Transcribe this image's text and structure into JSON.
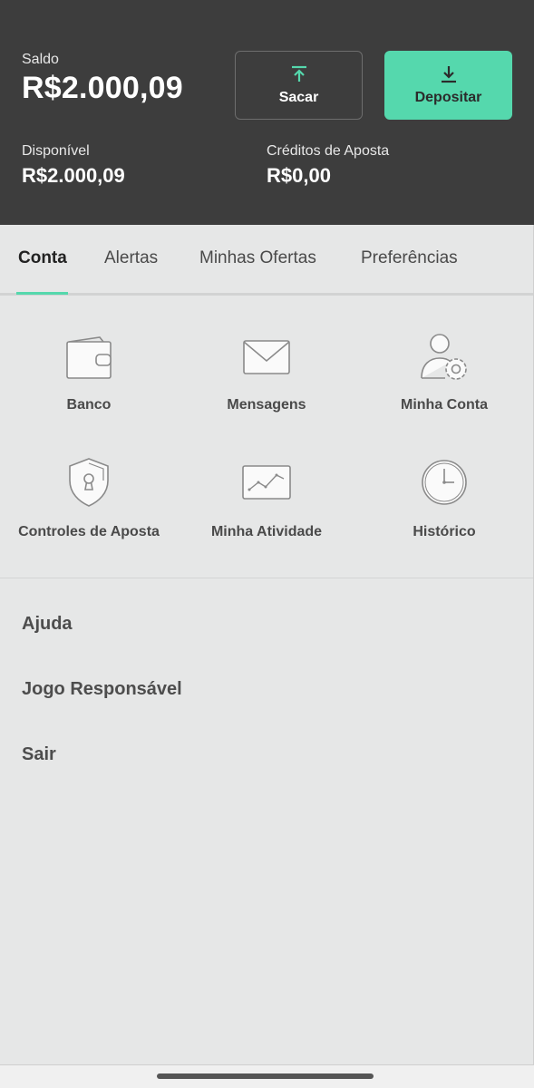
{
  "header": {
    "saldo_label": "Saldo",
    "saldo_value": "R$2.000,09",
    "sacar_label": "Sacar",
    "depositar_label": "Depositar",
    "disponivel_label": "Disponível",
    "disponivel_value": "R$2.000,09",
    "creditos_label": "Créditos de Aposta",
    "creditos_value": "R$0,00"
  },
  "tabs": [
    {
      "label": "Conta",
      "active": true
    },
    {
      "label": "Alertas",
      "active": false
    },
    {
      "label": "Minhas Ofertas",
      "active": false
    },
    {
      "label": "Preferências",
      "active": false
    }
  ],
  "grid": [
    {
      "label": "Banco",
      "icon": "wallet-icon"
    },
    {
      "label": "Mensagens",
      "icon": "envelope-icon"
    },
    {
      "label": "Minha Conta",
      "icon": "user-settings-icon"
    },
    {
      "label": "Controles de Aposta",
      "icon": "shield-lock-icon"
    },
    {
      "label": "Minha Atividade",
      "icon": "activity-chart-icon"
    },
    {
      "label": "Histórico",
      "icon": "clock-icon"
    }
  ],
  "list": [
    {
      "label": "Ajuda"
    },
    {
      "label": "Jogo Responsável"
    },
    {
      "label": "Sair"
    }
  ],
  "colors": {
    "header_bg": "#3d3d3d",
    "accent": "#55d8ad",
    "page_bg": "#e6e7e7"
  }
}
